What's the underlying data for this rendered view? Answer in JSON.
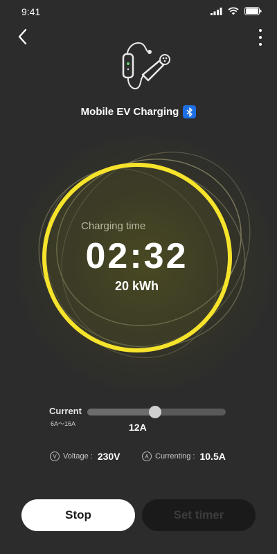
{
  "status_bar": {
    "time": "9:41"
  },
  "device": {
    "title": "Mobile EV Charging"
  },
  "charging": {
    "label": "Charging time",
    "time": "02:32",
    "energy": "20 kWh"
  },
  "current": {
    "label": "Current",
    "range": "6A～16A",
    "value": "12A",
    "min": 6,
    "max": 16,
    "level": 12
  },
  "readings": {
    "voltage_label": "Voltage :",
    "voltage_value": "230V",
    "voltage_icon_glyph": "V",
    "current_label": "Currenting :",
    "current_value": "10.5A",
    "current_icon_glyph": "A"
  },
  "actions": {
    "stop_label": "Stop",
    "timer_label": "Set timer"
  },
  "colors": {
    "accent_ring": "#f6e32b",
    "background": "#2c2c2c",
    "bluetooth_badge": "#1e6fe6"
  },
  "icons": [
    "back-arrow-icon",
    "more-vertical-icon",
    "wifi-icon",
    "signal-icon",
    "battery-icon",
    "bluetooth-icon",
    "ev-charger-icon",
    "voltage-icon",
    "current-icon"
  ]
}
